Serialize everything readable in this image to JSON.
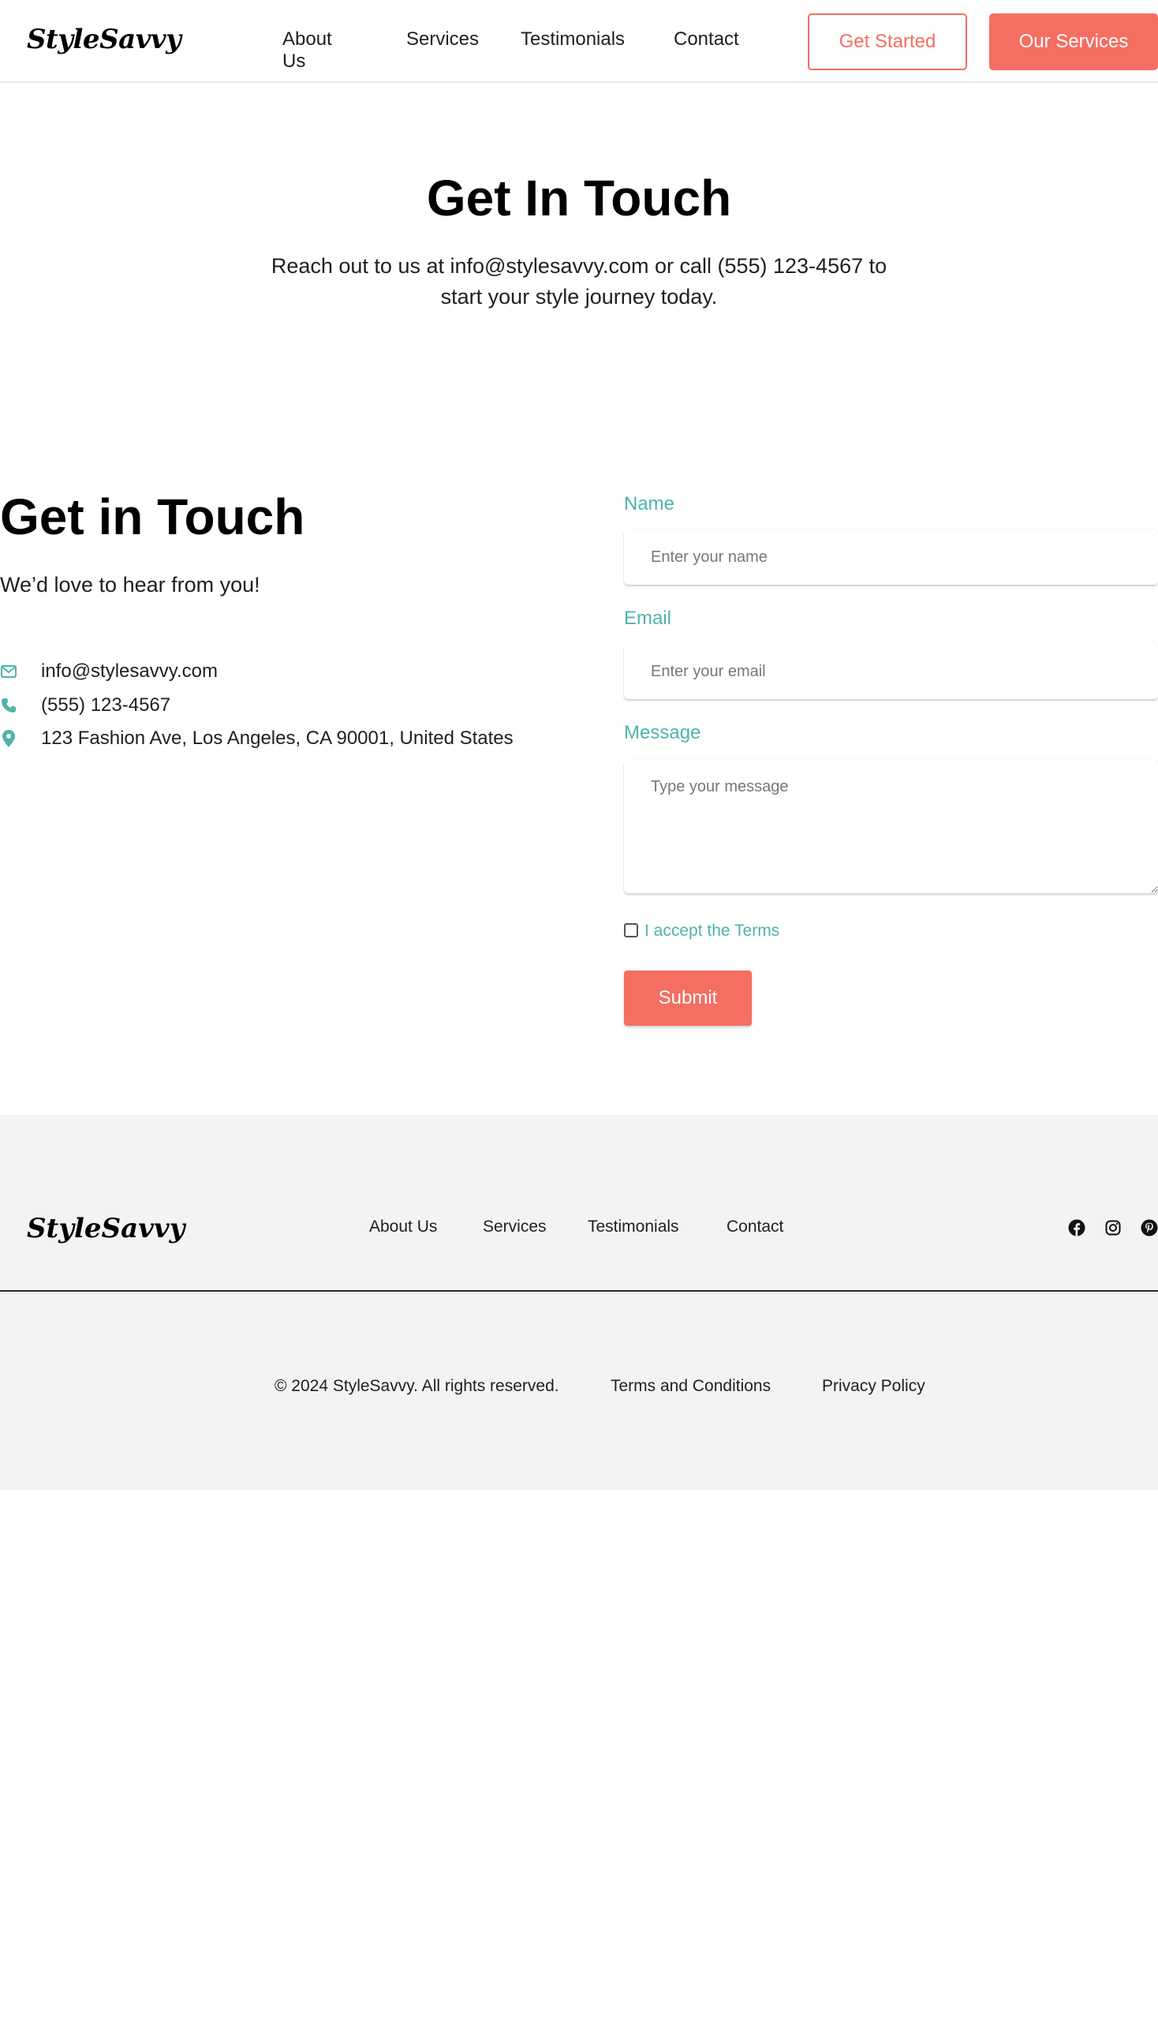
{
  "header": {
    "logo_text": "StyleSavvy",
    "nav": [
      "About Us",
      "Services",
      "Testimonials",
      "Contact"
    ],
    "get_started_label": "Get Started",
    "our_services_label": "Our Services"
  },
  "hero": {
    "title": "Get In Touch",
    "subtitle": "Reach out to us at info@stylesavvy.com or call (555) 123-4567 to start your style journey today."
  },
  "contact": {
    "title": "Get in Touch",
    "subtitle": "We’d love to hear from you!",
    "email": "info@stylesavvy.com",
    "phone": "(555) 123-4567",
    "address": "123 Fashion Ave, Los Angeles, CA 90001, United States",
    "icons": [
      "envelope-icon",
      "phone-icon",
      "map-pin-icon"
    ]
  },
  "form": {
    "name_label": "Name",
    "name_placeholder": "Enter your name",
    "email_label": "Email",
    "email_placeholder": "Enter your email",
    "message_label": "Message",
    "message_placeholder": "Type your message",
    "terms_label": "I accept the Terms",
    "submit_label": "Submit"
  },
  "footer": {
    "logo_text": "StyleSavvy",
    "nav": [
      "About Us",
      "Services",
      "Testimonials",
      "Contact"
    ],
    "social_icons": [
      "facebook-icon",
      "instagram-icon",
      "pinterest-icon"
    ],
    "copyright": "© 2024 StyleSavvy. All rights reserved.",
    "terms_link": "Terms and Conditions",
    "privacy_link": "Privacy Policy"
  },
  "colors": {
    "accent": "#f46e62",
    "teal": "#4fb3a9",
    "footer_bg": "#f2f3f5"
  }
}
